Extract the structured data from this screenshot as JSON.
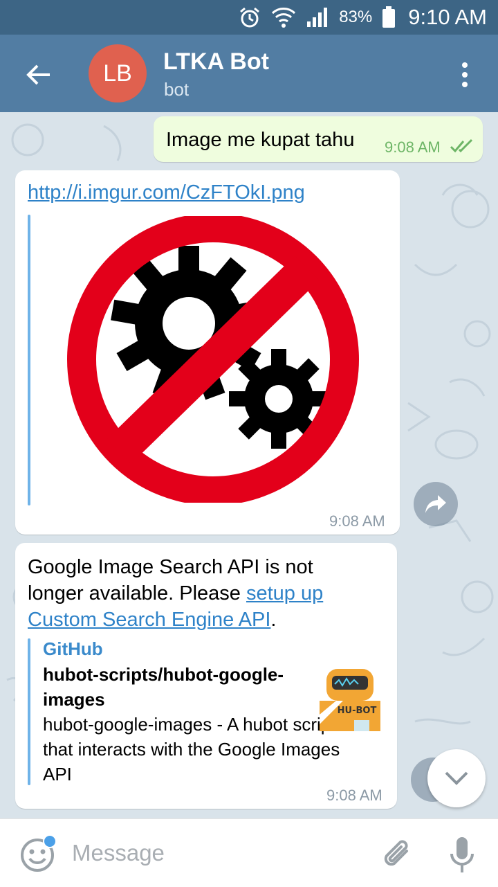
{
  "status_bar": {
    "battery_percent": "83%",
    "time": "9:10 AM",
    "icons": [
      "alarm-icon",
      "wifi-icon",
      "signal-icon",
      "battery-icon"
    ]
  },
  "header": {
    "avatar_initials": "LB",
    "title": "LTKA Bot",
    "subtitle": "bot",
    "icons": [
      "back-arrow-icon",
      "more-vert-icon"
    ]
  },
  "messages": {
    "outgoing": {
      "text": "Image me kupat tahu",
      "time": "9:08 AM"
    },
    "image_message": {
      "link": "http://i.imgur.com/CzFTOkI.png",
      "image_description_icon": "no-gears-icon",
      "time": "9:08 AM"
    },
    "text_message": {
      "text_prefix": "Google Image Search API is not longer available. Please ",
      "link_text": "setup up Custom Search Engine API",
      "text_suffix": ".",
      "preview": {
        "site": "GitHub",
        "title": "hubot-scripts/hubot-google-images",
        "description": "hubot-google-images - A hubot script that interacts with the Google Images API",
        "image_label": "HU-BOT"
      },
      "time": "9:08 AM"
    }
  },
  "input": {
    "placeholder": "Message",
    "icons": [
      "emoji-icon",
      "attach-icon",
      "mic-icon"
    ]
  },
  "colors": {
    "status_bar": "#3d6585",
    "app_bar": "#527da3",
    "avatar": "#e0614f",
    "outgoing_bubble": "#effdde",
    "link": "#2e82c8",
    "check_marks": "#6db566"
  }
}
